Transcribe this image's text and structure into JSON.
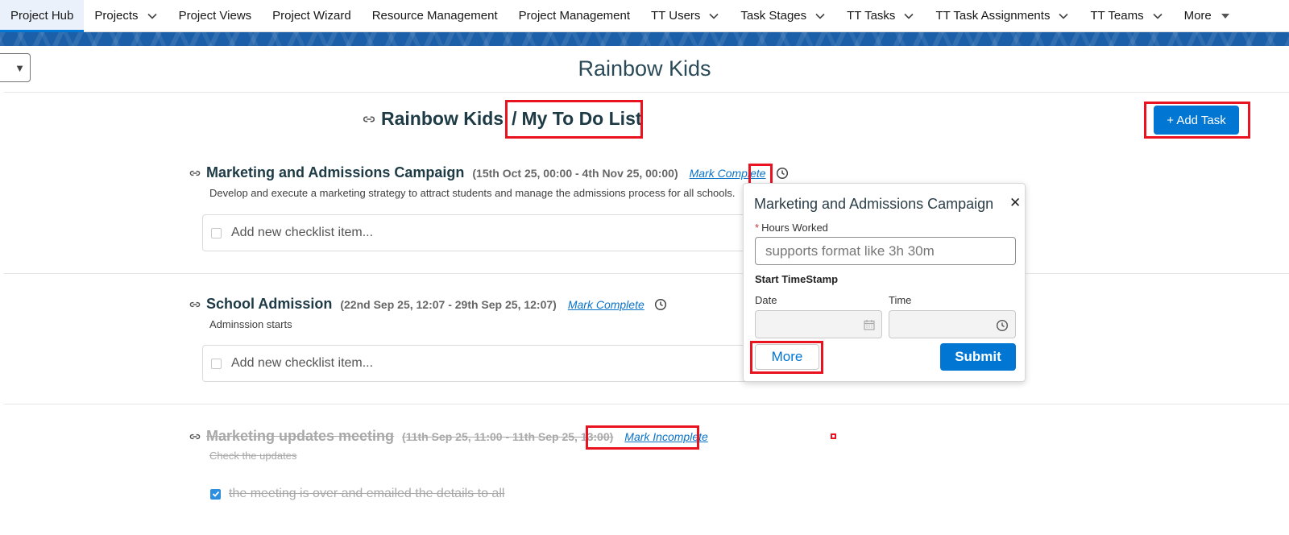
{
  "nav": {
    "items": [
      {
        "label": "Project Hub",
        "chevron": false,
        "active": true
      },
      {
        "label": "Projects",
        "chevron": true
      },
      {
        "label": "Project Views",
        "chevron": false
      },
      {
        "label": "Project Wizard",
        "chevron": false
      },
      {
        "label": "Resource Management",
        "chevron": false
      },
      {
        "label": "Project Management",
        "chevron": false
      },
      {
        "label": "TT Users",
        "chevron": true
      },
      {
        "label": "Task Stages",
        "chevron": true
      },
      {
        "label": "TT Tasks",
        "chevron": true
      },
      {
        "label": "TT Task Assignments",
        "chevron": true
      },
      {
        "label": "TT Teams",
        "chevron": true
      },
      {
        "label": "More",
        "chevron": true
      }
    ]
  },
  "page": {
    "title": "Rainbow Kids",
    "dropdown_glyph": "▼"
  },
  "breadcrumb": {
    "parent": "Rainbow Kids",
    "separator": "/",
    "current": "My To Do List"
  },
  "add_task_label": "+ Add Task",
  "tasks": [
    {
      "title": "Marketing and Admissions Campaign",
      "dates": "(15th Oct 25, 00:00 - 4th Nov 25, 00:00)",
      "mark_label": "Mark Complete",
      "description": "Develop and execute a marketing strategy to attract students and manage the admissions process for all schools.",
      "checklist_placeholder": "Add new checklist item..."
    },
    {
      "title": "School Admission",
      "dates": "(22nd Sep 25, 12:07 - 29th Sep 25, 12:07)",
      "mark_label": "Mark Complete",
      "description": "Adminssion starts",
      "checklist_placeholder": "Add new checklist item..."
    },
    {
      "title": "Marketing updates meeting",
      "dates": "(11th Sep 25, 11:00 - 11th Sep 25, 13:00)",
      "mark_label": "Mark Incomplete",
      "description": "Check the updates",
      "checklist_item": "the meeting is over and emailed the details to all",
      "completed": true
    }
  ],
  "popover": {
    "title": "Marketing and Admissions Campaign",
    "close_glyph": "✕",
    "hours_label": "Hours Worked",
    "required_mark": "*",
    "hours_placeholder": "supports format like 3h 30m",
    "start_label": "Start TimeStamp",
    "date_label": "Date",
    "time_label": "Time",
    "more_label": "More",
    "submit_label": "Submit"
  },
  "colors": {
    "accent": "#0176d3",
    "highlight": "#e8131f",
    "banner": "#1b5fa8"
  }
}
